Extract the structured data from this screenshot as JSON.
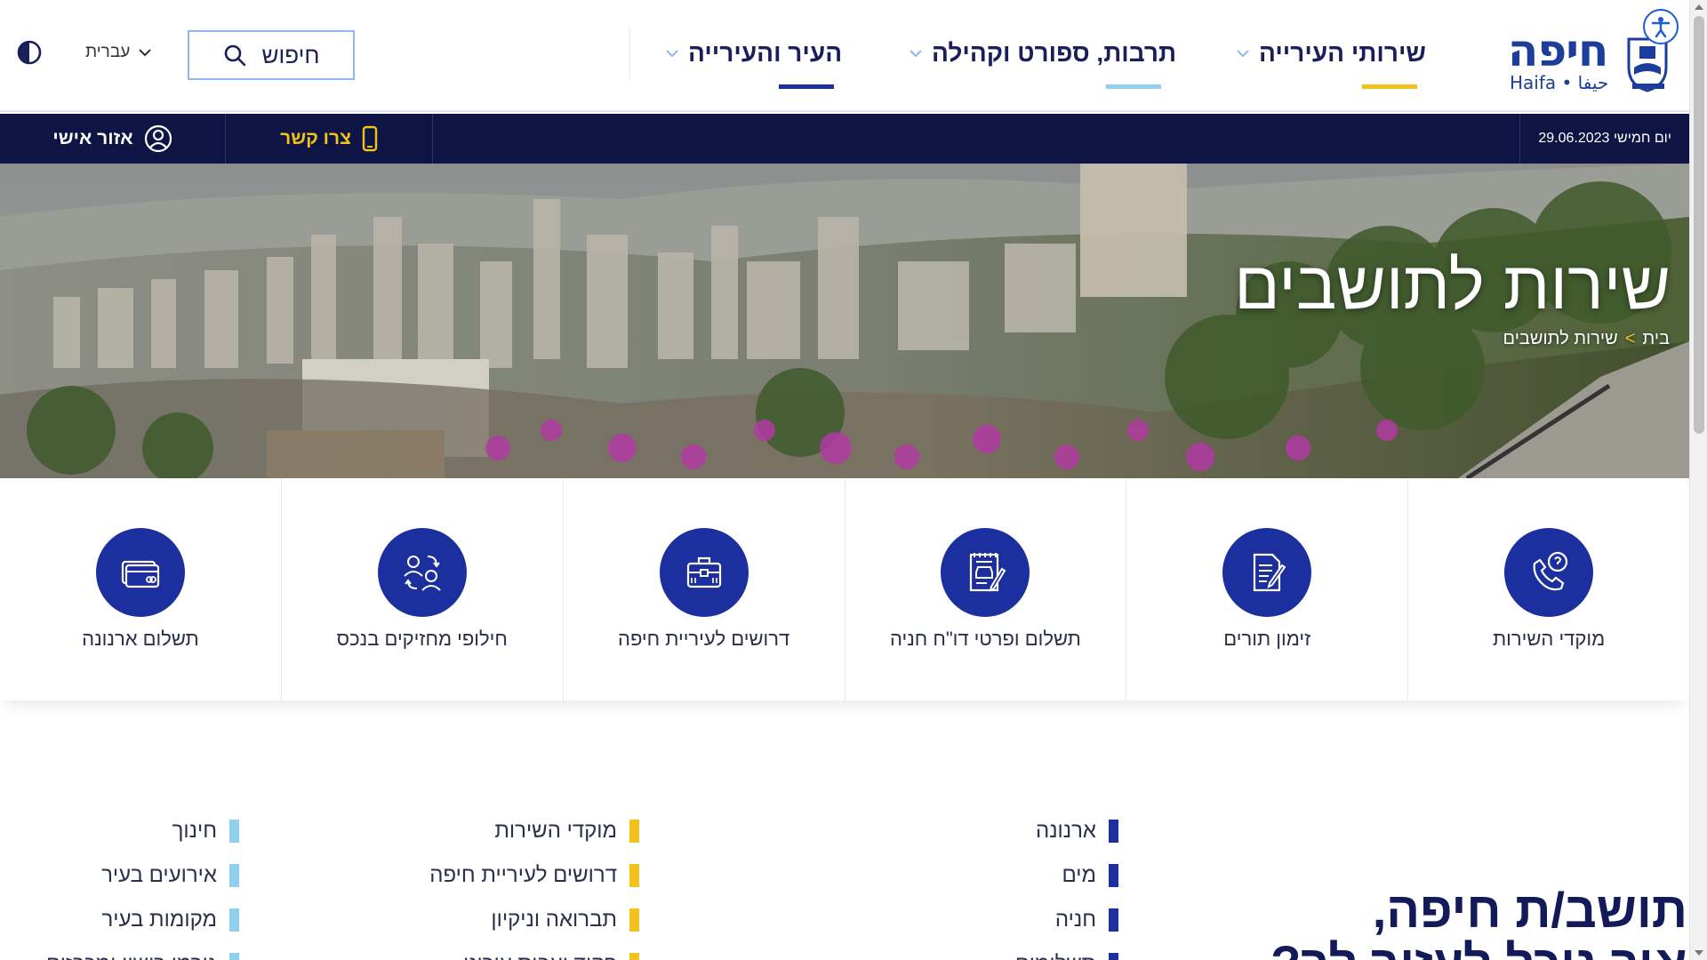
{
  "header": {
    "logo_he": "חיפה",
    "logo_sub": "Haifa • حيفا",
    "nav": [
      {
        "label": "שירותי העירייה",
        "accent": "#f2c21b"
      },
      {
        "label": "תרבות, ספורט וקהילה",
        "accent": "#8fd0ee"
      },
      {
        "label": "העיר והעירייה",
        "accent": "#1c2f9e"
      }
    ],
    "search_placeholder": "חיפוש",
    "language": "עברית",
    "icons": {
      "accessibility": "accessibility-icon",
      "search": "search-icon",
      "contrast": "contrast-icon",
      "chevron": "chevron-down-icon"
    }
  },
  "topbar": {
    "date": "יום חמישי 29.06.2023",
    "contact_label": "צרו קשר",
    "personal_label": "אזור אישי",
    "background": "#0e1545"
  },
  "hero": {
    "title": "שירות לתושבים",
    "breadcrumb": [
      "בית",
      ">",
      "שירות לתושבים"
    ]
  },
  "services": [
    {
      "label": "מוקדי השירות",
      "icon": "phone-help-icon"
    },
    {
      "label": "זימון תורים",
      "icon": "document-pen-icon"
    },
    {
      "label": "תשלום ופרטי דו\"ח חניה",
      "icon": "parking-ticket-icon"
    },
    {
      "label": "דרושים לעיריית חיפה",
      "icon": "briefcase-icon"
    },
    {
      "label": "חילופי מחזיקים בנכס",
      "icon": "people-swap-icon"
    },
    {
      "label": "תשלום ארנונה",
      "icon": "credit-card-icon"
    }
  ],
  "intro": {
    "line1": "תושב/ת חיפה,",
    "line2": "איך נוכל לעזור לך?"
  },
  "link_columns": [
    {
      "color": "#1c2f9e",
      "items": [
        "ארנונה",
        "מים",
        "חניה",
        "תשלומים"
      ]
    },
    {
      "color": "#f2c21b",
      "items": [
        "מוקדי השירות",
        "דרושים לעיריית חיפה",
        "תברואה וניקיון",
        "פקוד ועבוס עירוני"
      ]
    },
    {
      "color": "#8fd0ee",
      "items": [
        "חינוך",
        "אירועים בעיר",
        "מקומות בעיר",
        "גורמי רישוי ומכרזים"
      ]
    }
  ]
}
